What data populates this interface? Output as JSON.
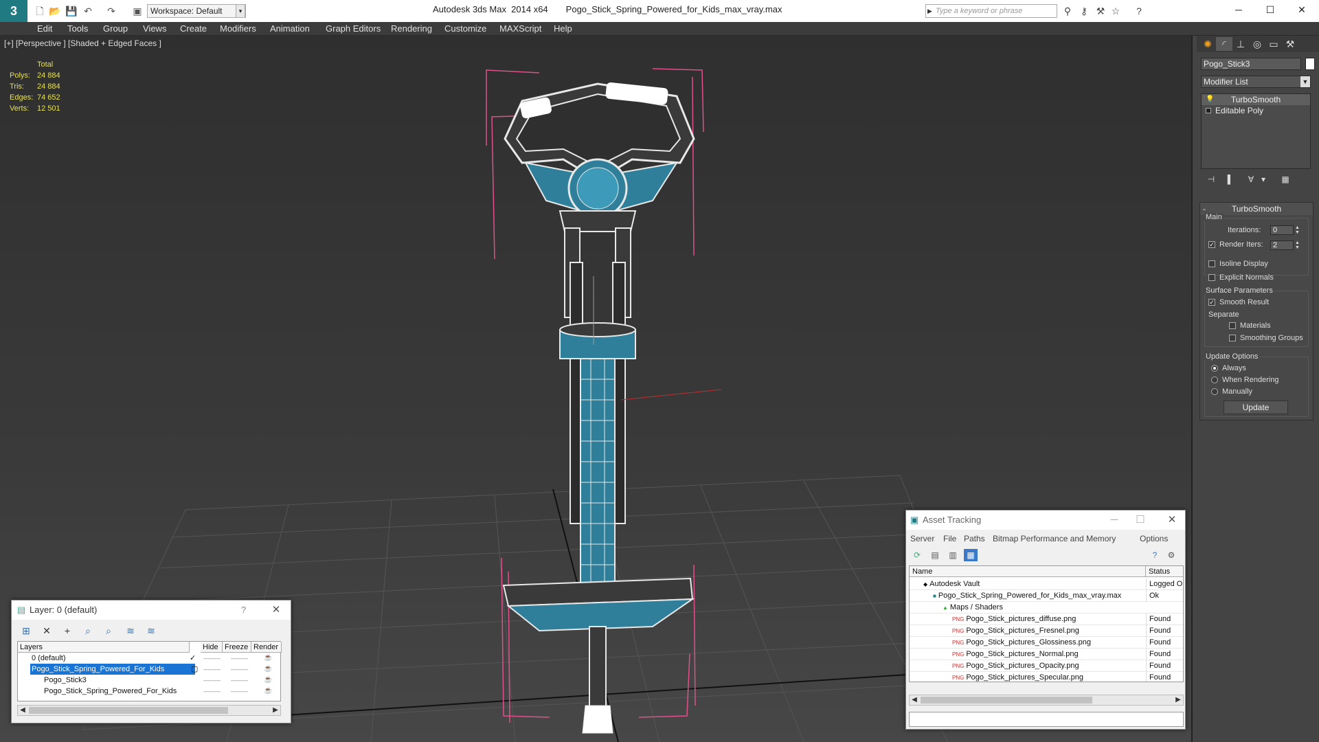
{
  "app": {
    "logo": "3",
    "workspace": "Workspace: Default",
    "title": "Autodesk 3ds Max  2014 x64",
    "filename": "Pogo_Stick_Spring_Powered_for_Kids_max_vray.max",
    "search_placeholder": "Type a keyword or phrase"
  },
  "menu": [
    "Edit",
    "Tools",
    "Group",
    "Views",
    "Create",
    "Modifiers",
    "Animation",
    "Graph Editors",
    "Rendering",
    "Customize",
    "MAXScript",
    "Help"
  ],
  "viewport": {
    "label": "[+] [Perspective ] [Shaded + Edged Faces ]",
    "stats_header": "Total",
    "stats": [
      {
        "k": "Polys:",
        "v": "24 884"
      },
      {
        "k": "Tris:",
        "v": "24 884"
      },
      {
        "k": "Edges:",
        "v": "74 652"
      },
      {
        "k": "Verts:",
        "v": "12 501"
      }
    ],
    "colors": {
      "stats": "#e8e25a",
      "bbox": "#e0508a",
      "wire": "#e8e8e8",
      "texture": "#2f7f9a"
    }
  },
  "panel": {
    "object_name": "Pogo_Stick3",
    "modifier_list": "Modifier List",
    "stack": [
      "TurboSmooth",
      "Editable Poly"
    ],
    "rollout_title": "TurboSmooth",
    "main_label": "Main",
    "iterations_label": "Iterations:",
    "iterations_value": "0",
    "render_iters_label": "Render Iters:",
    "render_iters_value": "2",
    "isoline": "Isoline Display",
    "explicit_normals": "Explicit Normals",
    "surface_params": "Surface Parameters",
    "smooth_result": "Smooth Result",
    "separate": "Separate",
    "materials": "Materials",
    "smoothing_groups": "Smoothing Groups",
    "update_options": "Update Options",
    "always": "Always",
    "when_rendering": "When Rendering",
    "manually": "Manually",
    "update_button": "Update"
  },
  "layers": {
    "title": "Layer: 0 (default)",
    "help": "?",
    "columns": [
      "Layers",
      "Hide",
      "Freeze",
      "Render"
    ],
    "rows": [
      {
        "name": "0 (default)",
        "indent": 1,
        "selected": false
      },
      {
        "name": "Pogo_Stick_Spring_Powered_For_Kids",
        "indent": 1,
        "selected": true
      },
      {
        "name": "Pogo_Stick3",
        "indent": 2,
        "selected": false
      },
      {
        "name": "Pogo_Stick_Spring_Powered_For_Kids",
        "indent": 2,
        "selected": false
      }
    ]
  },
  "assets": {
    "title": "Asset Tracking",
    "menu": [
      "Server",
      "File",
      "Paths",
      "Bitmap Performance and Memory",
      "Options"
    ],
    "columns": [
      "Name",
      "Status"
    ],
    "rows": [
      {
        "name": "Autodesk Vault",
        "status": "Logged O",
        "indent": 0,
        "icon": "vault-icon"
      },
      {
        "name": "Pogo_Stick_Spring_Powered_for_Kids_max_vray.max",
        "status": "Ok",
        "indent": 1,
        "icon": "max-file-icon"
      },
      {
        "name": "Maps / Shaders",
        "status": "",
        "indent": 2,
        "icon": "maps-folder-icon"
      },
      {
        "name": "Pogo_Stick_pictures_diffuse.png",
        "status": "Found",
        "indent": 3,
        "icon": "png-icon"
      },
      {
        "name": "Pogo_Stick_pictures_Fresnel.png",
        "status": "Found",
        "indent": 3,
        "icon": "png-icon"
      },
      {
        "name": "Pogo_Stick_pictures_Glossiness.png",
        "status": "Found",
        "indent": 3,
        "icon": "png-icon"
      },
      {
        "name": "Pogo_Stick_pictures_Normal.png",
        "status": "Found",
        "indent": 3,
        "icon": "png-icon"
      },
      {
        "name": "Pogo_Stick_pictures_Opacity.png",
        "status": "Found",
        "indent": 3,
        "icon": "png-icon"
      },
      {
        "name": "Pogo_Stick_pictures_Specular.png",
        "status": "Found",
        "indent": 3,
        "icon": "png-icon"
      }
    ]
  }
}
